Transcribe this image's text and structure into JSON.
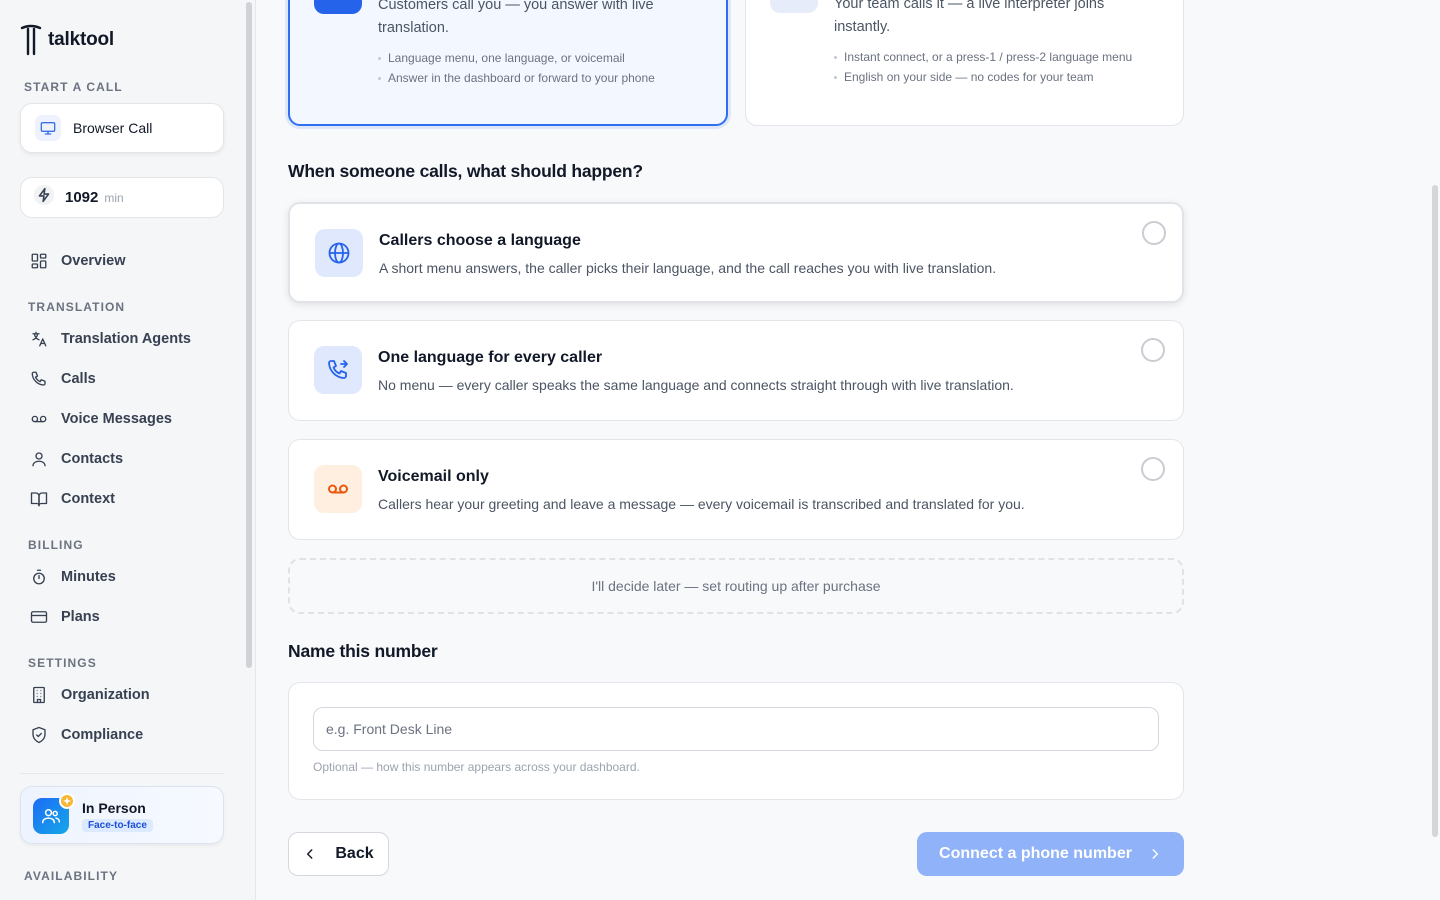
{
  "app": {
    "name": "talktool"
  },
  "sidebar": {
    "start_call_label": "START A CALL",
    "browser_call_label": "Browser Call",
    "minutes_value": "1092",
    "minutes_unit": "min",
    "overview_label": "Overview",
    "sections": {
      "translation": "TRANSLATION",
      "billing": "BILLING",
      "settings": "SETTINGS",
      "availability": "AVAILABILITY"
    },
    "translation_items": [
      "Translation Agents",
      "Calls",
      "Voice Messages",
      "Contacts",
      "Context"
    ],
    "billing_items": [
      "Minutes",
      "Plans"
    ],
    "settings_items": [
      "Organization",
      "Compliance"
    ],
    "in_person": {
      "title": "In Person",
      "tag": "Face-to-face"
    }
  },
  "top_cards": {
    "left": {
      "description": "Customers call you — you answer with live translation.",
      "bullets": [
        "Language menu, one language, or voicemail",
        "Answer in the dashboard or forward to your phone"
      ]
    },
    "right": {
      "description": "Your team calls it — a live interpreter joins instantly.",
      "bullets": [
        "Instant connect, or a press-1 / press-2 language menu",
        "English on your side — no codes for your team"
      ]
    }
  },
  "routing": {
    "heading": "When someone calls, what should happen?",
    "options": [
      {
        "title": "Callers choose a language",
        "description": "A short menu answers, the caller picks their language, and the call reaches you with live translation."
      },
      {
        "title": "One language for every caller",
        "description": "No menu — every caller speaks the same language and connects straight through with live translation."
      },
      {
        "title": "Voicemail only",
        "description": "Callers hear your greeting and leave a message — every voicemail is transcribed and translated for you."
      }
    ],
    "decide_later": "I'll decide later — set routing up after purchase"
  },
  "naming": {
    "heading": "Name this number",
    "placeholder": "e.g. Front Desk Line",
    "value": "",
    "hint": "Optional — how this number appears across your dashboard."
  },
  "footer": {
    "back_label": "Back",
    "connect_label": "Connect a phone number"
  },
  "colors": {
    "accent": "#2f6ff2",
    "connect_disabled": "#8fb2f8",
    "voicemail_accent": "#ea580c"
  }
}
